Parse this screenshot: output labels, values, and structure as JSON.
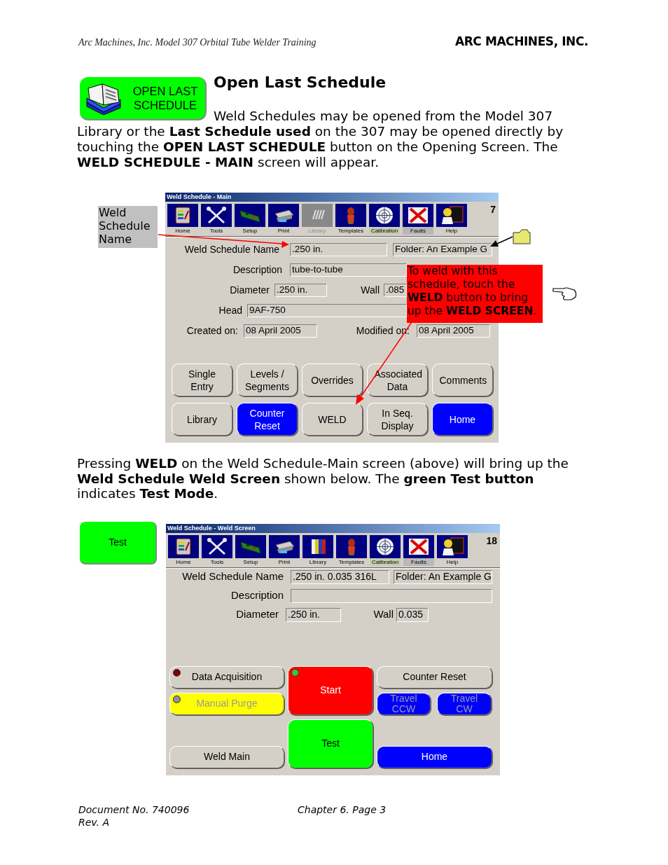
{
  "header": {
    "title": "Arc Machines, Inc. Model 307 Orbital  Tube Welder Training",
    "logo": "ARC MACHINES, INC."
  },
  "intro": {
    "button": "OPEN LAST SCHEDULE",
    "heading": "Open Last Schedule",
    "paragraph": "Weld Schedules may be opened from the Model 307 Library or the **Last Schedule used** on the 307 may be opened directly by touching the **OPEN LAST SCHEDULE** button on the Opening Screen. The **WELD SCHEDULE - MAIN** screen will appear."
  },
  "figure_1": {
    "annotation_label": "Weld Schedule Name",
    "callout": "To weld with this schedule, touch the **WELD** button to bring up the **WELD SCREEN**.",
    "screen": {
      "title": "Weld Schedule - Main",
      "corner_text": "7",
      "toolbar": [
        {
          "label": "Home",
          "disabled": false
        },
        {
          "label": "Tools",
          "disabled": false
        },
        {
          "label": "Setup",
          "disabled": false
        },
        {
          "label": "Print",
          "disabled": false
        },
        {
          "label": "Library",
          "disabled": true
        },
        {
          "label": "Templates",
          "disabled": false
        },
        {
          "label": "Calibration",
          "disabled": false,
          "color": "#c8ccb0"
        },
        {
          "label": "Faults",
          "disabled": false,
          "color": "#b8b8b8"
        },
        {
          "label": "Help",
          "disabled": false
        }
      ],
      "form_rows": [
        [
          {
            "label": "Weld Schedule Name",
            "value": ".250 in."
          },
          {
            "value": "Folder: An Example G"
          }
        ],
        [
          {
            "label": "Description",
            "value": "tube-to-tube"
          }
        ],
        [
          {
            "label": "Diameter",
            "value": ".250 in."
          },
          {
            "label": "Wall",
            "value": ".085"
          }
        ],
        [
          {
            "label": "Head",
            "value": "9AF-750"
          }
        ],
        [
          {
            "label": "Created on:",
            "value": "08 April 2005"
          },
          {
            "label": "Modified on:",
            "value": "08 April 2005"
          }
        ]
      ],
      "buttons": [
        {
          "label": "Single Entry",
          "color": "#d4d0c8"
        },
        {
          "label": "Levels / Segments",
          "color": "#d4d0c8"
        },
        {
          "label": "Overrides",
          "color": "#d4d0c8"
        },
        {
          "label": "Associated Data",
          "color": "#d4d0c8"
        },
        {
          "label": "Comments",
          "color": "#d4d0c8"
        },
        {
          "label": "Library",
          "color": "#d4d0c8"
        },
        {
          "label": "Counter Reset",
          "color": "#0000ff"
        },
        {
          "label": "WELD",
          "color": "#d4d0c8"
        },
        {
          "label": "In Seq. Display",
          "color": "#d4d0c8"
        },
        {
          "label": "Home",
          "color": "#0000ff"
        }
      ]
    }
  },
  "caption": "Pressing **WELD** on the Weld Schedule-Main screen (above) will bring up the **Weld Schedule Weld Screen** shown below. The **green Test button** indicates **Test Mode**.",
  "figure_2": {
    "side_button": "Test",
    "screen": {
      "title": "Weld Schedule - Weld Screen",
      "corner_text": "18",
      "toolbar": [
        {
          "label": "Home",
          "disabled": false
        },
        {
          "label": "Tools",
          "disabled": false
        },
        {
          "label": "Setup",
          "disabled": false
        },
        {
          "label": "Print",
          "disabled": false
        },
        {
          "label": "Library",
          "disabled": false
        },
        {
          "label": "Templates",
          "disabled": false
        },
        {
          "label": "Calibration",
          "disabled": false,
          "color": "#c8ccb0"
        },
        {
          "label": "Faults",
          "disabled": false,
          "color": "#b8b8b8"
        },
        {
          "label": "Help",
          "disabled": false
        }
      ],
      "form_rows": [
        [
          {
            "label": "Weld Schedule Name",
            "value": ".250 in. 0.035 316L"
          },
          {
            "value": "Folder: An Example G"
          }
        ],
        [
          {
            "label": "Description"
          }
        ],
        [
          {
            "label": "Diameter",
            "value": ".250 in."
          },
          {
            "label": "Wall",
            "value": "0.035"
          }
        ]
      ],
      "buttons": [
        {
          "label": "Data Acquisition",
          "color": "#d4d0c8",
          "disabled": false,
          "led": {
            "color": "#800000"
          }
        },
        {
          "label": "Start",
          "color": "#ff0000",
          "disabled": false,
          "led": {
            "color": "#40c040"
          }
        },
        {
          "label": "Counter Reset",
          "color": "#d4d0c8",
          "disabled": false
        },
        {
          "label": "Manual Purge",
          "color": "#ffff00",
          "disabled": true,
          "led": {
            "color": "#909090"
          }
        },
        {
          "label": "Travel CCW",
          "color": "#0000ff",
          "disabled": true
        },
        {
          "label": "Travel CW",
          "color": "#0000ff",
          "disabled": true
        },
        {
          "label": "Test",
          "color": "#00ff00",
          "disabled": false
        },
        {
          "label": "Weld Main",
          "color": "#d4d0c8",
          "disabled": false
        },
        {
          "label": "Home",
          "color": "#0000ff",
          "disabled": false
        }
      ]
    }
  },
  "footer": {
    "document": "Document No. 740096",
    "revision": "Rev. A",
    "page": "Chapter 6. Page 3"
  }
}
